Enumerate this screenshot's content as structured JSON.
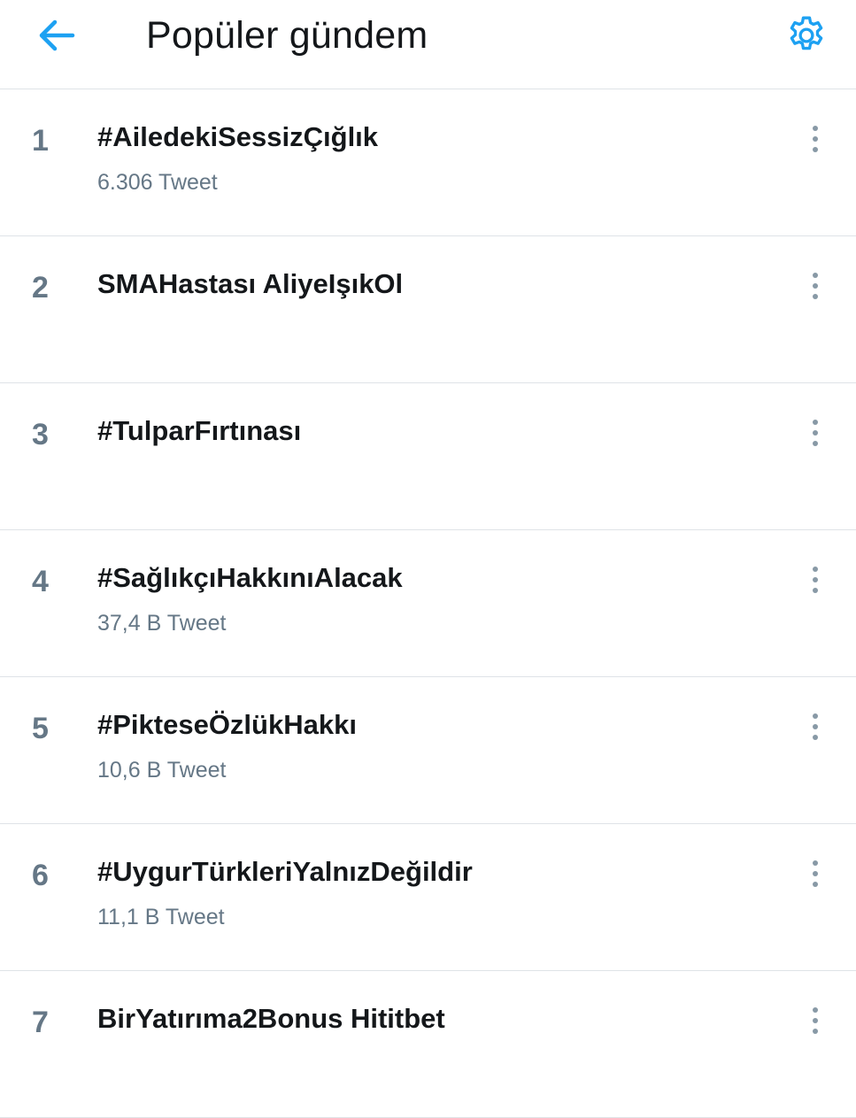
{
  "header": {
    "title": "Popüler gündem",
    "back_icon": "arrow-left-icon",
    "settings_icon": "gear-icon"
  },
  "colors": {
    "accent": "#1da1f2",
    "text_primary": "#14171a",
    "text_secondary": "#657786",
    "divider": "#dfe3e7"
  },
  "trends": [
    {
      "rank": "1",
      "name": "#AiledekiSessizÇığlık",
      "count": "6.306 Tweet"
    },
    {
      "rank": "2",
      "name": "SMAHastası AliyeIşıkOl",
      "count": ""
    },
    {
      "rank": "3",
      "name": "#TulparFırtınası",
      "count": ""
    },
    {
      "rank": "4",
      "name": "#SağlıkçıHakkınıAlacak",
      "count": "37,4 B Tweet"
    },
    {
      "rank": "5",
      "name": "#PikteseÖzlükHakkı",
      "count": "10,6 B Tweet"
    },
    {
      "rank": "6",
      "name": "#UygurTürkleriYalnızDeğildir",
      "count": "11,1 B Tweet"
    },
    {
      "rank": "7",
      "name": "BirYatırıma2Bonus Hititbet",
      "count": ""
    }
  ]
}
